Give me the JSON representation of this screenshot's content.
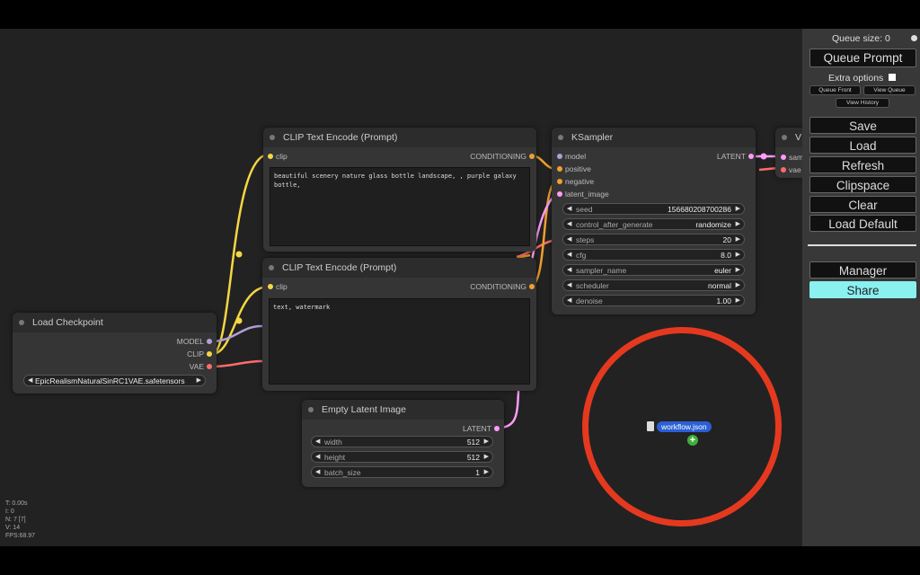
{
  "nodes": {
    "clip_text_1": {
      "title": "CLIP Text Encode (Prompt)",
      "input_clip": "clip",
      "output": "CONDITIONING",
      "text": "beautiful scenery nature glass bottle landscape, , purple galaxy bottle,"
    },
    "clip_text_2": {
      "title": "CLIP Text Encode (Prompt)",
      "input_clip": "clip",
      "output": "CONDITIONING",
      "text": "text, watermark"
    },
    "ksampler": {
      "title": "KSampler",
      "inputs": [
        "model",
        "positive",
        "negative",
        "latent_image"
      ],
      "output": "LATENT",
      "widgets": [
        {
          "label": "seed",
          "value": "156680208700286"
        },
        {
          "label": "control_after_generate",
          "value": "randomize"
        },
        {
          "label": "steps",
          "value": "20"
        },
        {
          "label": "cfg",
          "value": "8.0"
        },
        {
          "label": "sampler_name",
          "value": "euler"
        },
        {
          "label": "scheduler",
          "value": "normal"
        },
        {
          "label": "denoise",
          "value": "1.00"
        }
      ]
    },
    "vae_decode": {
      "title": "V",
      "inputs": [
        "sam",
        "vae"
      ]
    },
    "load_checkpoint": {
      "title": "Load Checkpoint",
      "outputs": [
        "MODEL",
        "CLIP",
        "VAE"
      ],
      "ckpt_value": "EpicRealismNaturalSinRC1VAE.safetensors"
    },
    "empty_latent": {
      "title": "Empty Latent Image",
      "output": "LATENT",
      "widgets": [
        {
          "label": "width",
          "value": "512"
        },
        {
          "label": "height",
          "value": "512"
        },
        {
          "label": "batch_size",
          "value": "1"
        }
      ]
    }
  },
  "stats": {
    "t": "T: 0.00s",
    "i": "I: 0",
    "n": "N: 7 [7]",
    "v": "V: 14",
    "fps": "FPS:68.97"
  },
  "panel": {
    "queue_size": "Queue size: 0",
    "queue_prompt": "Queue Prompt",
    "extra_options": "Extra options",
    "queue_front": "Queue Front",
    "view_queue": "View Queue",
    "view_history": "View History",
    "save": "Save",
    "load": "Load",
    "refresh": "Refresh",
    "clipspace": "Clipspace",
    "clear": "Clear",
    "load_default": "Load Default",
    "manager": "Manager",
    "share": "Share"
  },
  "drag": {
    "filename": "workflow.json"
  },
  "colors": {
    "model": "#b39ddb",
    "clip": "#f5d742",
    "vae": "#ff6b6b",
    "conditioning": "#f0a030",
    "latent": "#ff9cf9",
    "share_bg": "#8af0f0",
    "drop_ring": "#e5391f"
  }
}
